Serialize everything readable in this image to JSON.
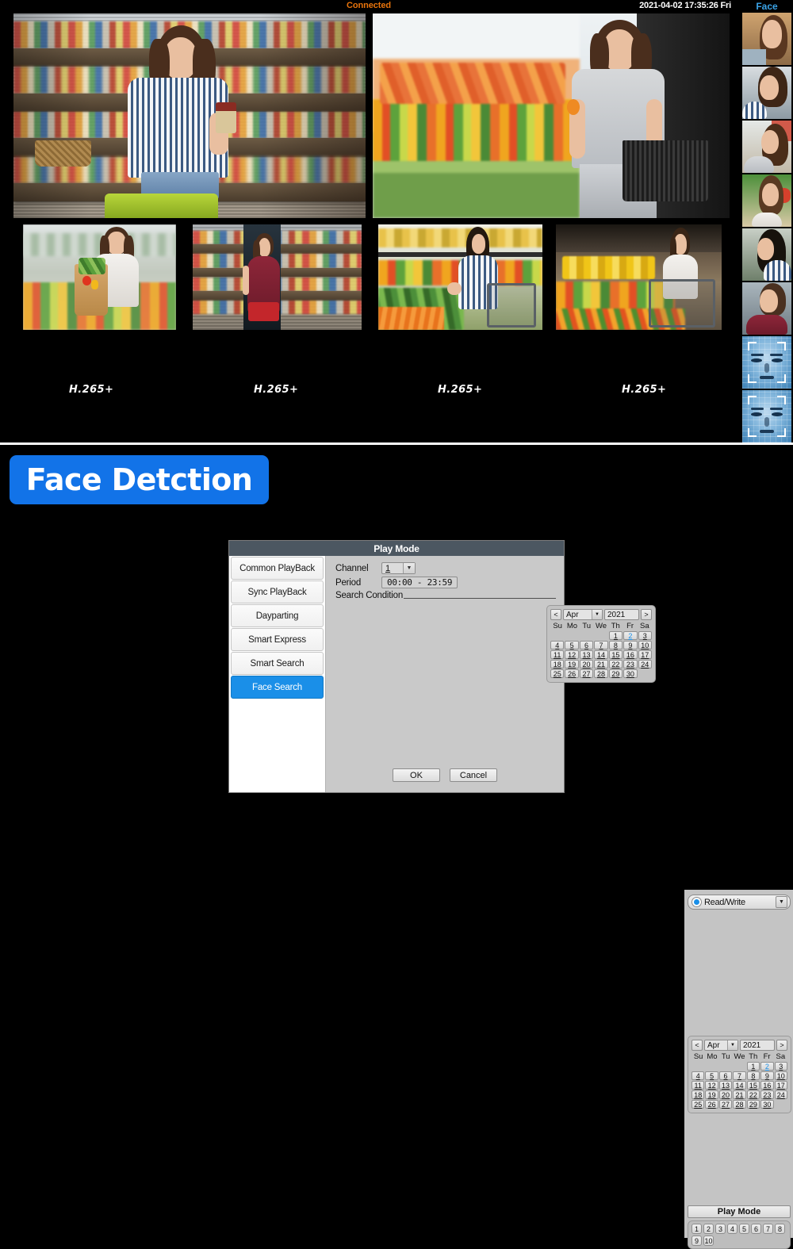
{
  "status_bar": {
    "connection": "Connected",
    "datetime": "2021-04-02 17:35:26 Fri",
    "face_panel_title": "Face"
  },
  "live_view": {
    "codec_labels": [
      "H.265+",
      "H.265+",
      "H.265+",
      "H.265+"
    ],
    "main_panes": [
      {
        "name": "channel-1-woman-holding-jar"
      },
      {
        "name": "channel-2-woman-at-produce"
      }
    ],
    "thumbnails": [
      {
        "name": "channel-3-woman-with-grocery-bag"
      },
      {
        "name": "channel-4-woman-with-red-basket"
      },
      {
        "name": "channel-5-woman-picking-vegetables"
      },
      {
        "name": "channel-6-woman-with-cart"
      }
    ],
    "face_captures": [
      {
        "name": "face-capture-1",
        "type": "photo"
      },
      {
        "name": "face-capture-2",
        "type": "photo"
      },
      {
        "name": "face-capture-3",
        "type": "photo"
      },
      {
        "name": "face-capture-4",
        "type": "photo"
      },
      {
        "name": "face-capture-5",
        "type": "photo"
      },
      {
        "name": "face-capture-6",
        "type": "photo"
      },
      {
        "name": "face-capture-7",
        "type": "biometric-scan"
      },
      {
        "name": "face-capture-8",
        "type": "biometric-scan"
      }
    ]
  },
  "banner": {
    "text": "Face Detction",
    "background_color": "#1273e8",
    "text_color": "#ffffff"
  },
  "dialog": {
    "title": "Play Mode",
    "modes": [
      {
        "label": "Common PlayBack",
        "selected": false
      },
      {
        "label": "Sync PlayBack",
        "selected": false
      },
      {
        "label": "Dayparting",
        "selected": false
      },
      {
        "label": "Smart Express",
        "selected": false
      },
      {
        "label": "Smart Search",
        "selected": false
      },
      {
        "label": "Face Search",
        "selected": true
      }
    ],
    "channel_label": "Channel",
    "channel_value": "1",
    "period_label": "Period",
    "period_value": "00:00  -  23:59",
    "search_condition_label": "Search Condition",
    "ok_label": "OK",
    "cancel_label": "Cancel",
    "selected_accent": "#1a8fe8"
  },
  "calendar": {
    "prev_label": "<",
    "next_label": ">",
    "month": "Apr",
    "year": "2021",
    "day_headers": [
      "Su",
      "Mo",
      "Tu",
      "We",
      "Th",
      "Fr",
      "Sa"
    ],
    "leading_blanks": 4,
    "days": [
      1,
      2,
      3,
      4,
      5,
      6,
      7,
      8,
      9,
      10,
      11,
      12,
      13,
      14,
      15,
      16,
      17,
      18,
      19,
      20,
      21,
      22,
      23,
      24,
      25,
      26,
      27,
      28,
      29,
      30
    ],
    "selected_day": 2
  },
  "right_panel": {
    "readwrite_label": "Read/Write",
    "play_mode_button": "Play Mode",
    "channel_buttons": [
      "1",
      "2",
      "3",
      "4",
      "5",
      "6",
      "7",
      "8",
      "9",
      "10"
    ]
  },
  "icons": {
    "dropdown_arrow": "▼",
    "prev_arrow": "<",
    "next_arrow": ">"
  }
}
